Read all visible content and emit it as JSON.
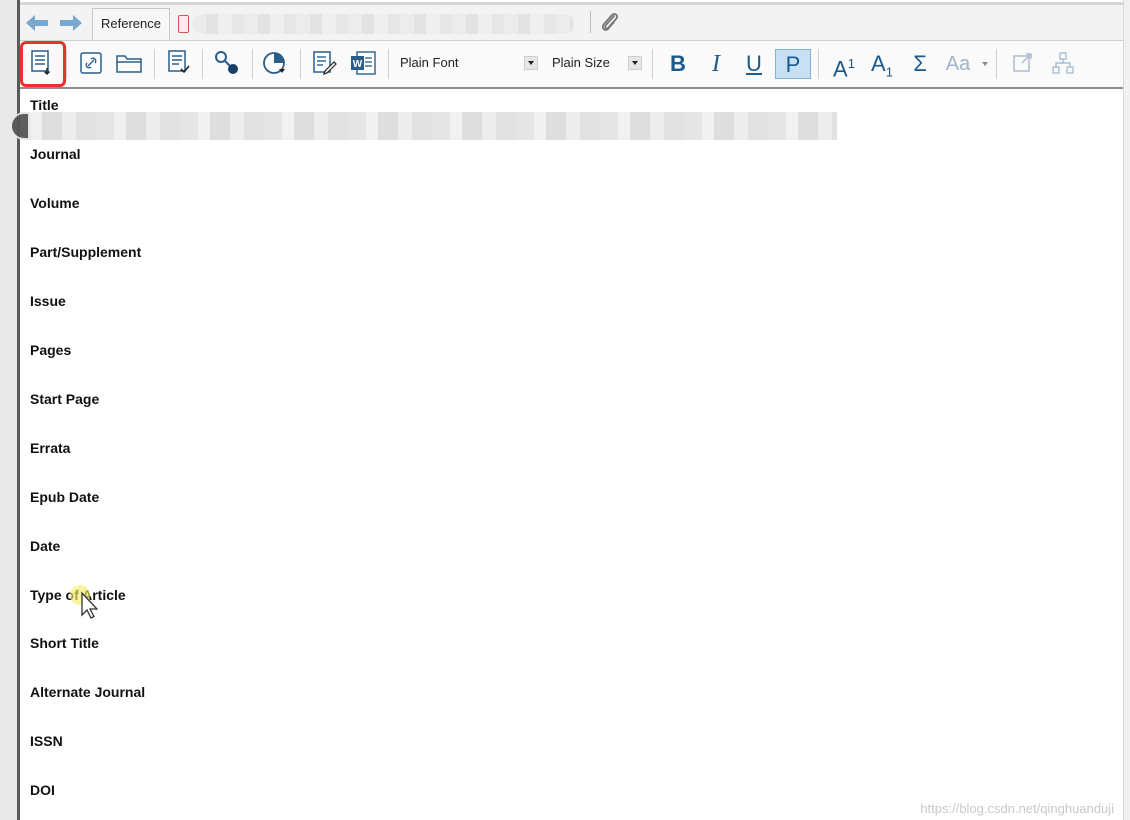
{
  "tabs": {
    "reference_label": "Reference"
  },
  "toolbar": {
    "font_value": "Plain Font",
    "size_value": "Plain Size",
    "bold_label": "B",
    "italic_label": "I",
    "underline_label": "U",
    "plain_label": "P",
    "superscript_label": "A",
    "superscript_digit": "1",
    "subscript_label": "A",
    "subscript_digit": "1",
    "symbol_label": "Σ",
    "case_label": "Aa"
  },
  "fields": [
    "Title",
    "Journal",
    "Volume",
    "Part/Supplement",
    "Issue",
    "Pages",
    "Start Page",
    "Errata",
    "Epub Date",
    "Date",
    "Type of Article",
    "Short Title",
    "Alternate Journal",
    "ISSN",
    "DOI"
  ],
  "watermark": "https://blog.csdn.net/qinghuanduji",
  "colors": {
    "highlight": "#e8322f",
    "accent": "#1a5a8c",
    "plain_active_bg": "#c7e0f4"
  }
}
